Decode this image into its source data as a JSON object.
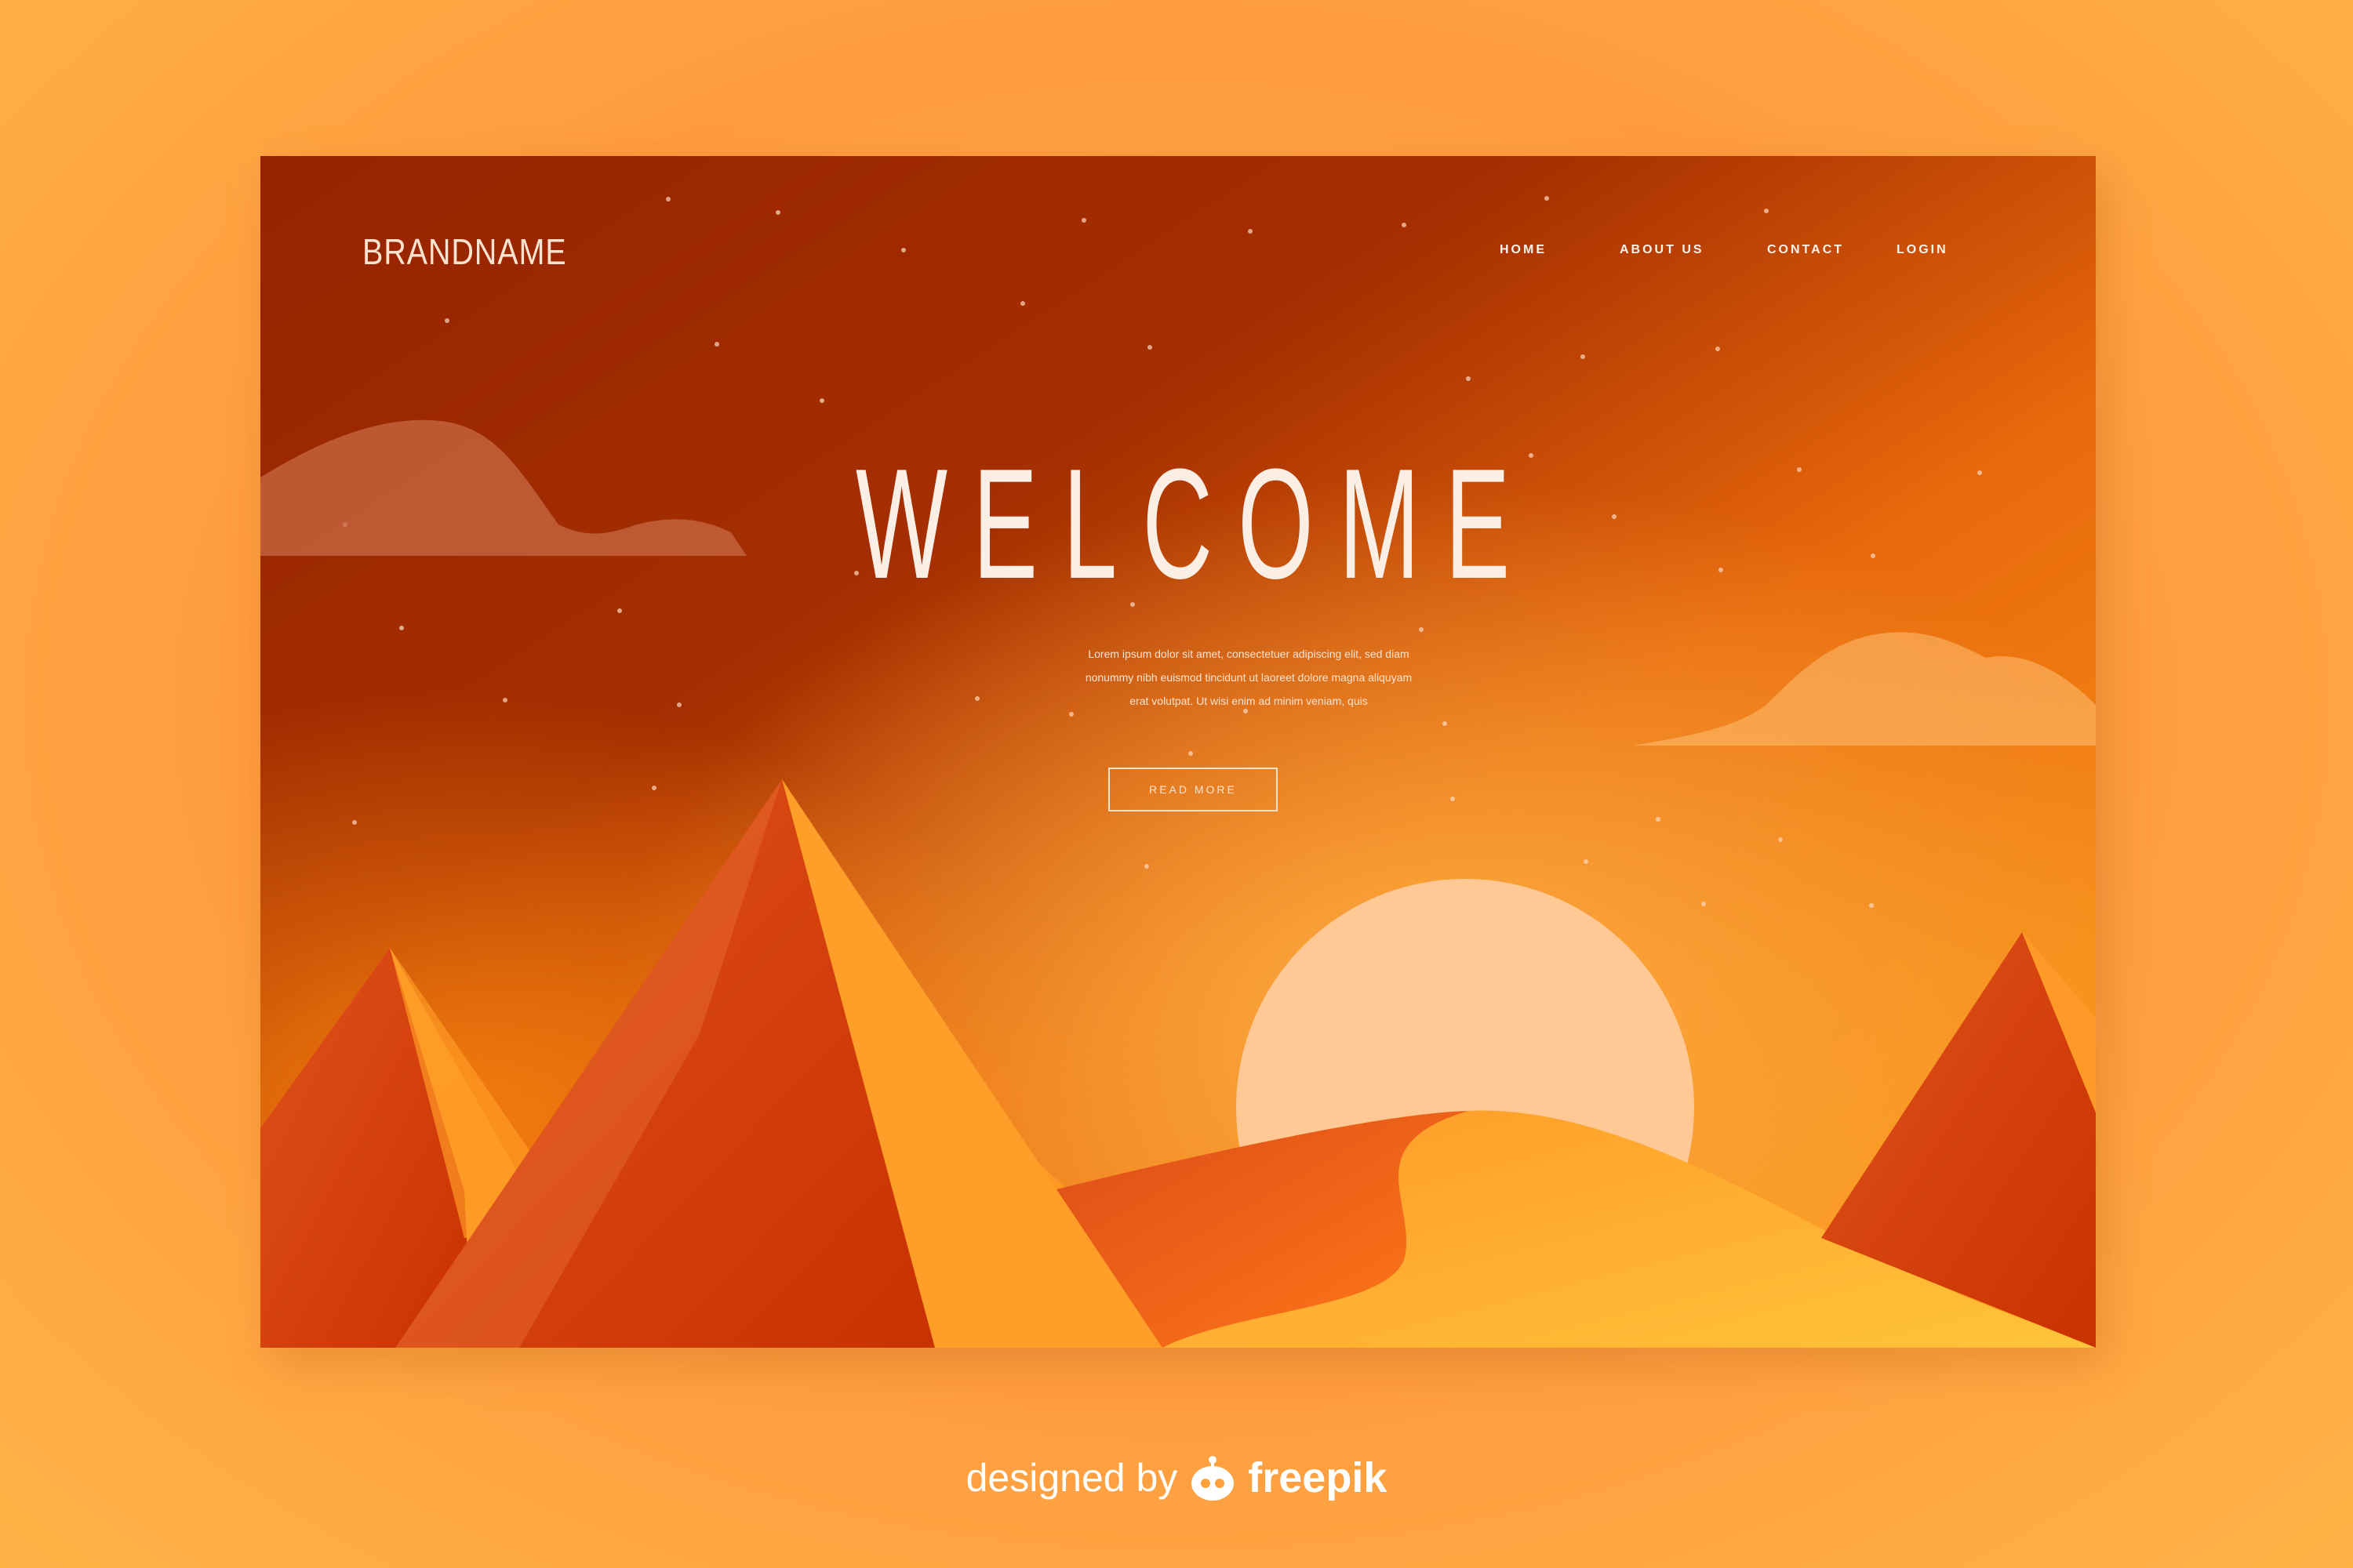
{
  "header": {
    "brand": "BRANDNAME",
    "nav": [
      "HOME",
      "ABOUT US",
      "CONTACT",
      "LOGIN"
    ]
  },
  "hero": {
    "title": "WELCOME",
    "paragraph": [
      "Lorem ipsum dolor sit amet, consectetuer adipiscing elit, sed diam",
      "nonummy nibh euismod tincidunt ut laoreet dolore magna aliquyam",
      "erat volutpat. Ut wisi enim ad minim veniam, quis"
    ],
    "button": "READ MORE"
  },
  "credit": {
    "text": "designed by",
    "brand": "freepik"
  },
  "colors": {
    "sky_dark": "#9a2500",
    "sky_orange": "#f57a1a",
    "sun": "#ffc894",
    "pyramid_red": "#d3400e",
    "dune_gold": "#ffb02e"
  }
}
